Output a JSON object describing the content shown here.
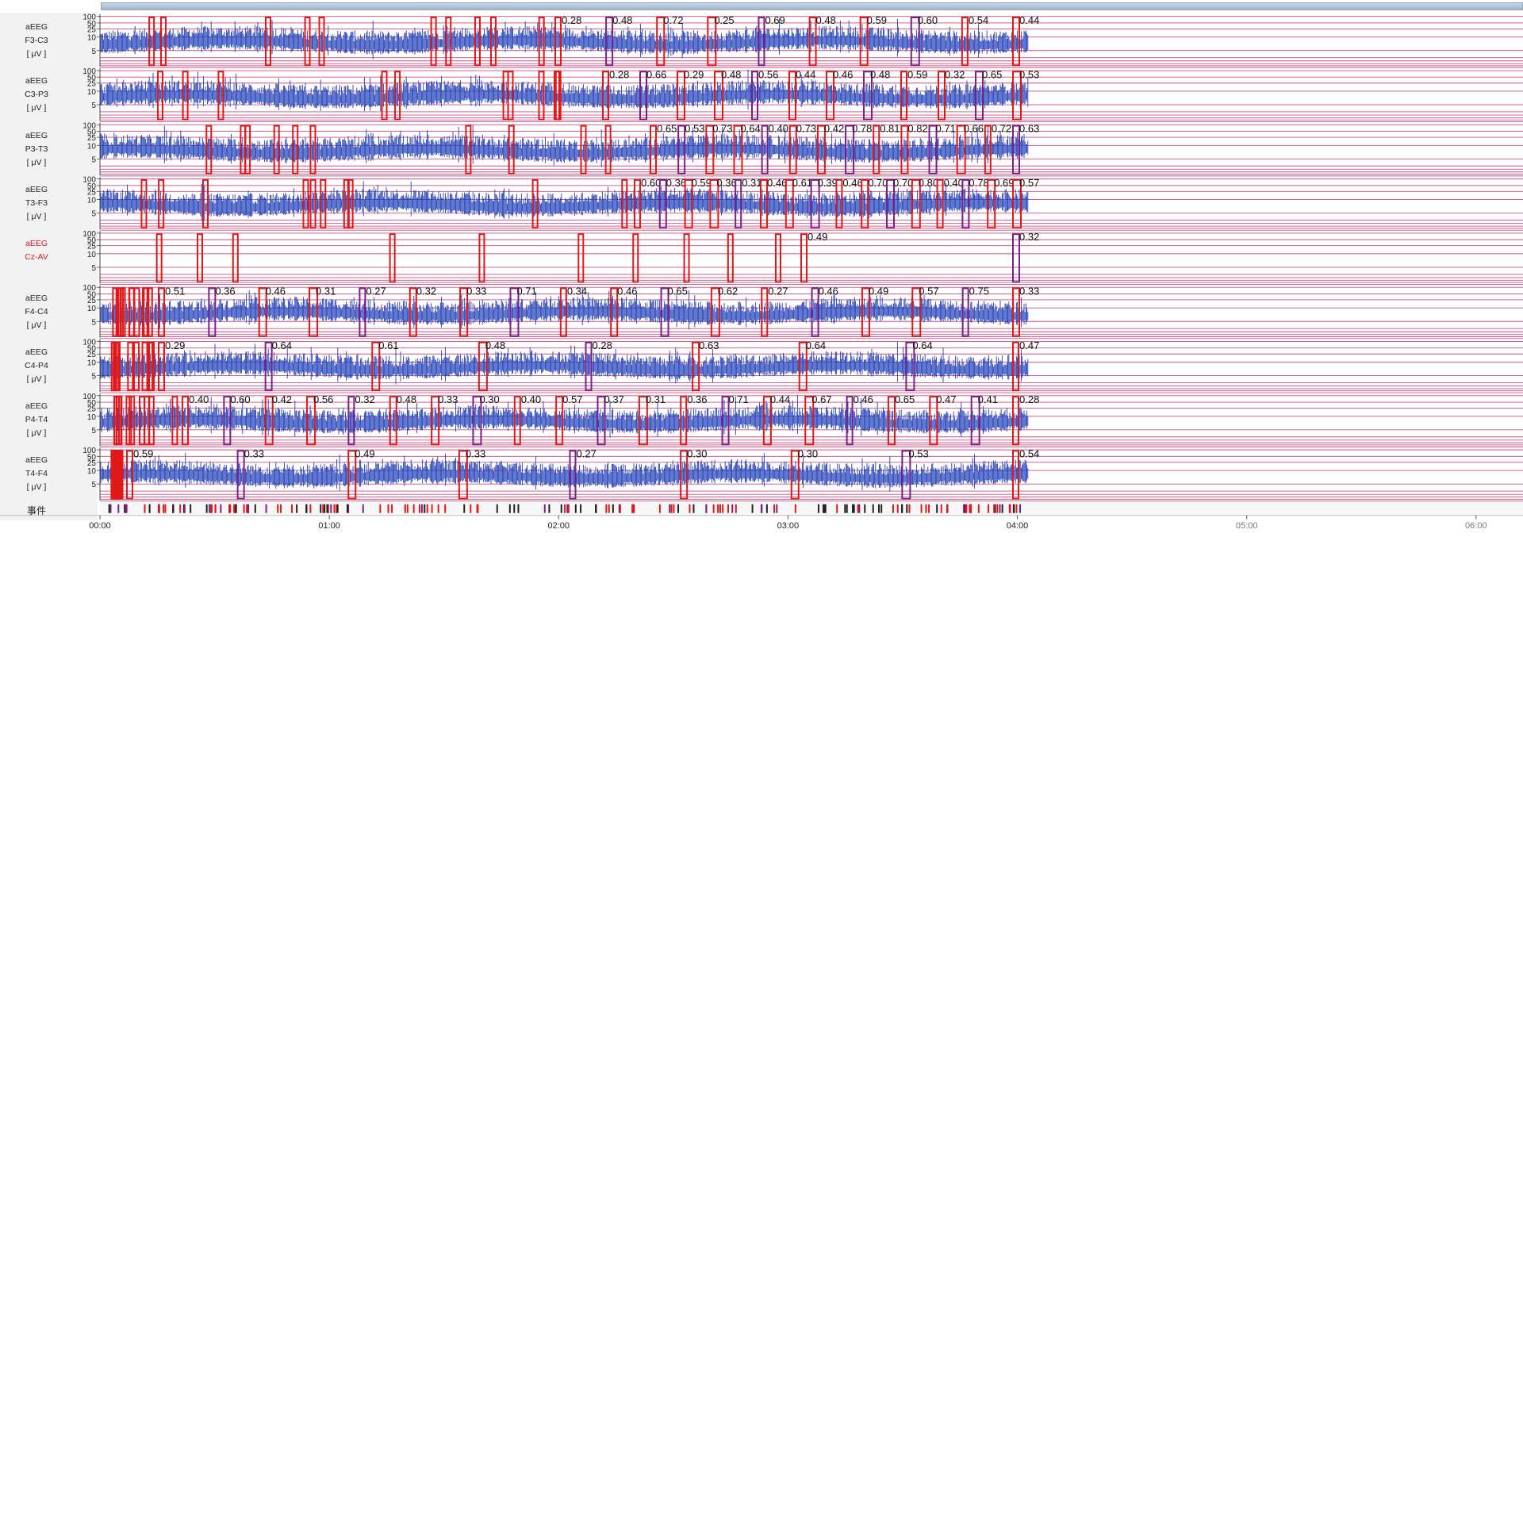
{
  "colors": {
    "signal": "#1f3fb8",
    "event_box_red": "#e01818",
    "event_box_purple": "#7a1f8a",
    "grid_line": "#c0306a",
    "label_red": "#d42020",
    "panel_bg": "#f2f2f2"
  },
  "window": {
    "scrollbar": "horizontal-scrollbar"
  },
  "channels": [
    {
      "type": "aEEG",
      "name": "F3-C3",
      "unit": "[ μV ]",
      "red": false,
      "values": [
        "0.28",
        "0.48",
        "0.72",
        "0.25",
        "0.69",
        "0.48",
        "0.59",
        "0.60",
        "0.54",
        "0.44"
      ]
    },
    {
      "type": "aEEG",
      "name": "C3-P3",
      "unit": "[ μV ]",
      "red": false,
      "values": [
        "0.28",
        "0.66",
        "0.29",
        "0.48",
        "0.56",
        "0.44",
        "0.46",
        "0.48",
        "0.59",
        "0.32",
        "0.65",
        "0.53"
      ]
    },
    {
      "type": "aEEG",
      "name": "P3-T3",
      "unit": "[ μV ]",
      "red": false,
      "values": [
        "0.65",
        "0.53",
        "0.73",
        "0.64",
        "0.40",
        "0.73",
        "0.42",
        "0.78",
        "0.81",
        "0.82",
        "0.71",
        "0.66",
        "0.72",
        "0.63"
      ]
    },
    {
      "type": "aEEG",
      "name": "T3-F3",
      "unit": "[ μV ]",
      "red": false,
      "values": [
        "0.60",
        "0.36",
        "0.59",
        "0.36",
        "0.31",
        "0.46",
        "0.61",
        "0.39",
        "0.46",
        "0.70",
        "0.70",
        "0.80",
        "0.40",
        "0.78",
        "0.69",
        "0.57"
      ]
    },
    {
      "type": "aEEG",
      "name": "Cz-AV",
      "unit": "",
      "red": true,
      "values": [
        "0.49",
        "0.32"
      ]
    },
    {
      "type": "aEEG",
      "name": "F4-C4",
      "unit": "[ μV ]",
      "red": false,
      "values": [
        "0.51",
        "0.36",
        "0.46",
        "0.31",
        "0.27",
        "0.32",
        "0.33",
        "0.71",
        "0.34",
        "0.46",
        "0.65",
        "0.62",
        "0.27",
        "0.46",
        "0.49",
        "0.57",
        "0.75",
        "0.33"
      ]
    },
    {
      "type": "aEEG",
      "name": "C4-P4",
      "unit": "[ μV ]",
      "red": false,
      "values": [
        "0.29",
        "0.64",
        "0.61",
        "0.48",
        "0.28",
        "0.63",
        "0.64",
        "0.64",
        "0.47"
      ]
    },
    {
      "type": "aEEG",
      "name": "P4-T4",
      "unit": "[ μV ]",
      "red": false,
      "values": [
        "0.40",
        "0.60",
        "0.42",
        "0.56",
        "0.32",
        "0.48",
        "0.33",
        "0.30",
        "0.40",
        "0.57",
        "0.37",
        "0.31",
        "0.36",
        "0.71",
        "0.44",
        "0.67",
        "0.46",
        "0.65",
        "0.47",
        "0.41",
        "0.28"
      ]
    },
    {
      "type": "aEEG",
      "name": "T4-F4",
      "unit": "[ μV ]",
      "red": false,
      "values": [
        "0.59",
        "0.33",
        "0.49",
        "0.33",
        "0.27",
        "0.30",
        "0.30",
        "0.53",
        "0.54"
      ]
    }
  ],
  "y_ticks": [
    "100",
    "50",
    "25",
    "10",
    "5"
  ],
  "events_label": "事件",
  "x_ticks": [
    {
      "label": "00:00",
      "grey": false
    },
    {
      "label": "01:00",
      "grey": false
    },
    {
      "label": "02:00",
      "grey": false
    },
    {
      "label": "03:00",
      "grey": false
    },
    {
      "label": "04:00",
      "grey": false
    },
    {
      "label": "05:00",
      "grey": true
    },
    {
      "label": "06:00",
      "grey": true
    }
  ]
}
